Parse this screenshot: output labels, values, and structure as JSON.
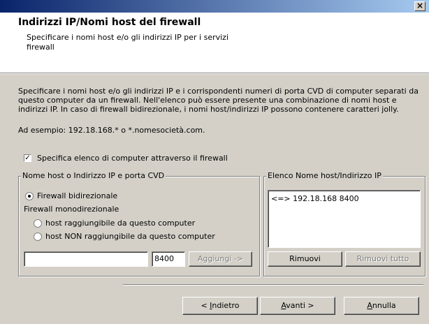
{
  "window": {
    "close_glyph": "×",
    "close_icon": "close-icon"
  },
  "header": {
    "title": "Indirizzi IP/Nomi host del firewall",
    "subtitle": "Specificare i nomi host e/o gli indirizzi IP per i servizi firewall"
  },
  "description": "Specificare i nomi host e/o gli indirizzi IP e i corrispondenti numeri di porta CVD di computer separati da questo computer da un firewall. Nell'elenco può essere presente una combinazione di nomi host e indirizzi IP. In caso di firewall bidirezionale, i nomi host/indirizzi IP possono contenere caratteri jolly.",
  "example": "Ad esempio: 192.18.168.* o *.nomesocietà.com.",
  "specify_checkbox": {
    "label": "Specifica elenco di computer attraverso il firewall",
    "checked": true
  },
  "left_group": {
    "legend": "Nome host o Indirizzo IP e porta CVD",
    "radio_bidirectional": "Firewall bidirezionale",
    "mono_label": "Firewall monodirezionale",
    "radio_reachable": "host raggiungibile da questo computer",
    "radio_not_reachable": "host NON raggiungibile da questo computer",
    "host_value": "",
    "port_value": "8400",
    "add_button": "Aggiungi ->"
  },
  "right_group": {
    "legend": "Elenco Nome host/Indirizzo IP",
    "items": [
      "<=> 192.18.168 8400"
    ],
    "remove_button": "Rimuovi",
    "remove_all_button": "Rimuovi tutto"
  },
  "footer": {
    "back_prefix": "< ",
    "back_acc": "I",
    "back_rest": "ndietro",
    "next_acc": "A",
    "next_rest": "vanti >",
    "cancel_acc": "A",
    "cancel_rest": "nnulla"
  },
  "colors": {
    "titlebar_start": "#0a246a",
    "titlebar_end": "#a6caf0",
    "face": "#d4d0c8"
  }
}
